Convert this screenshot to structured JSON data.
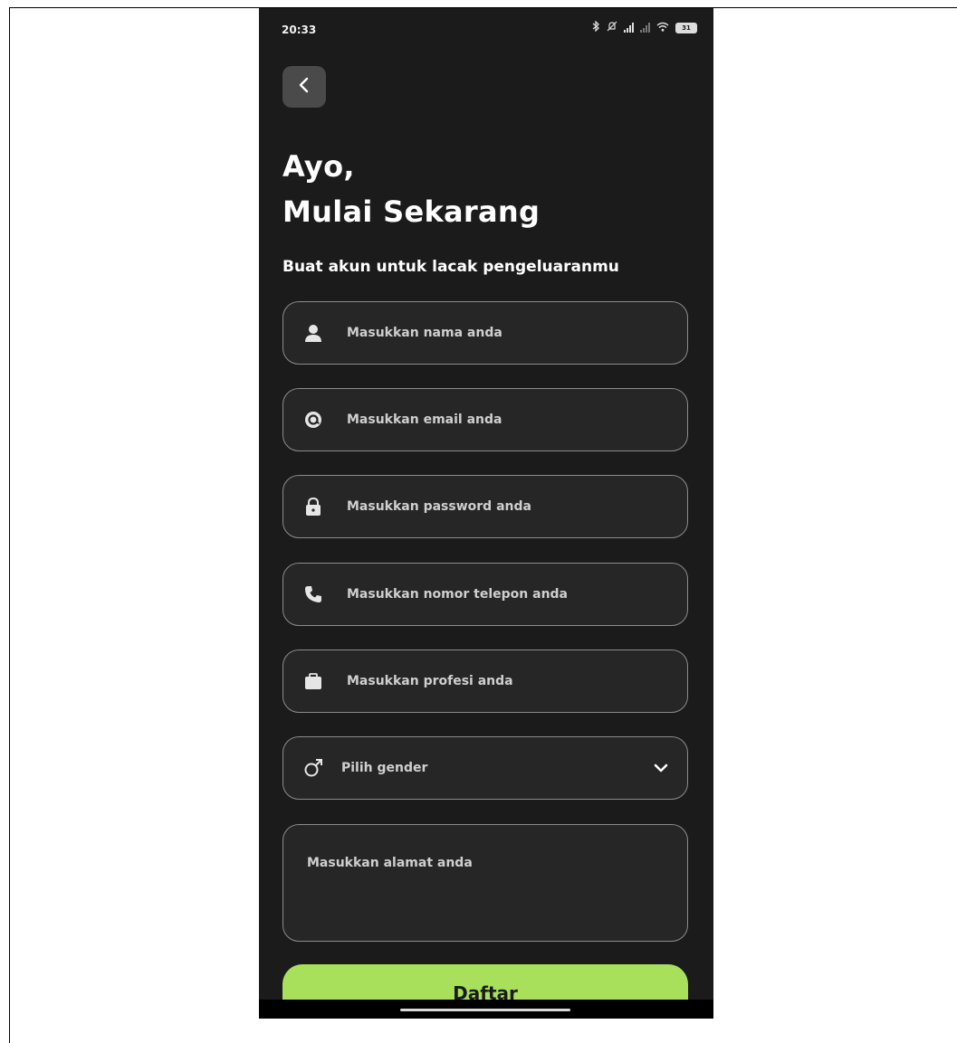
{
  "status_bar": {
    "time": "20:33",
    "icons": [
      "bluetooth-icon",
      "mute-icon",
      "signal-icon",
      "signal-icon",
      "wifi-icon",
      "battery-icon"
    ],
    "battery_label": "31"
  },
  "header": {
    "back_icon": "chevron-left-icon",
    "title_line1": "Ayo,",
    "title_line2": "Mulai Sekarang",
    "subtitle": "Buat akun untuk lacak pengeluaranmu"
  },
  "form": {
    "name_placeholder": "Masukkan nama anda",
    "email_placeholder": "Masukkan email anda",
    "password_placeholder": "Masukkan password anda",
    "phone_placeholder": "Masukkan nomor telepon anda",
    "profession_placeholder": "Masukkan profesi anda",
    "gender_placeholder": "Pilih gender",
    "address_placeholder": "Masukkan alamat anda",
    "submit_label": "Daftar"
  },
  "colors": {
    "background": "#1b1b1b",
    "field_background": "#262626",
    "field_border": "#8c8c8c",
    "accent": "#a8e05b",
    "back_button": "#4a4a4a"
  }
}
